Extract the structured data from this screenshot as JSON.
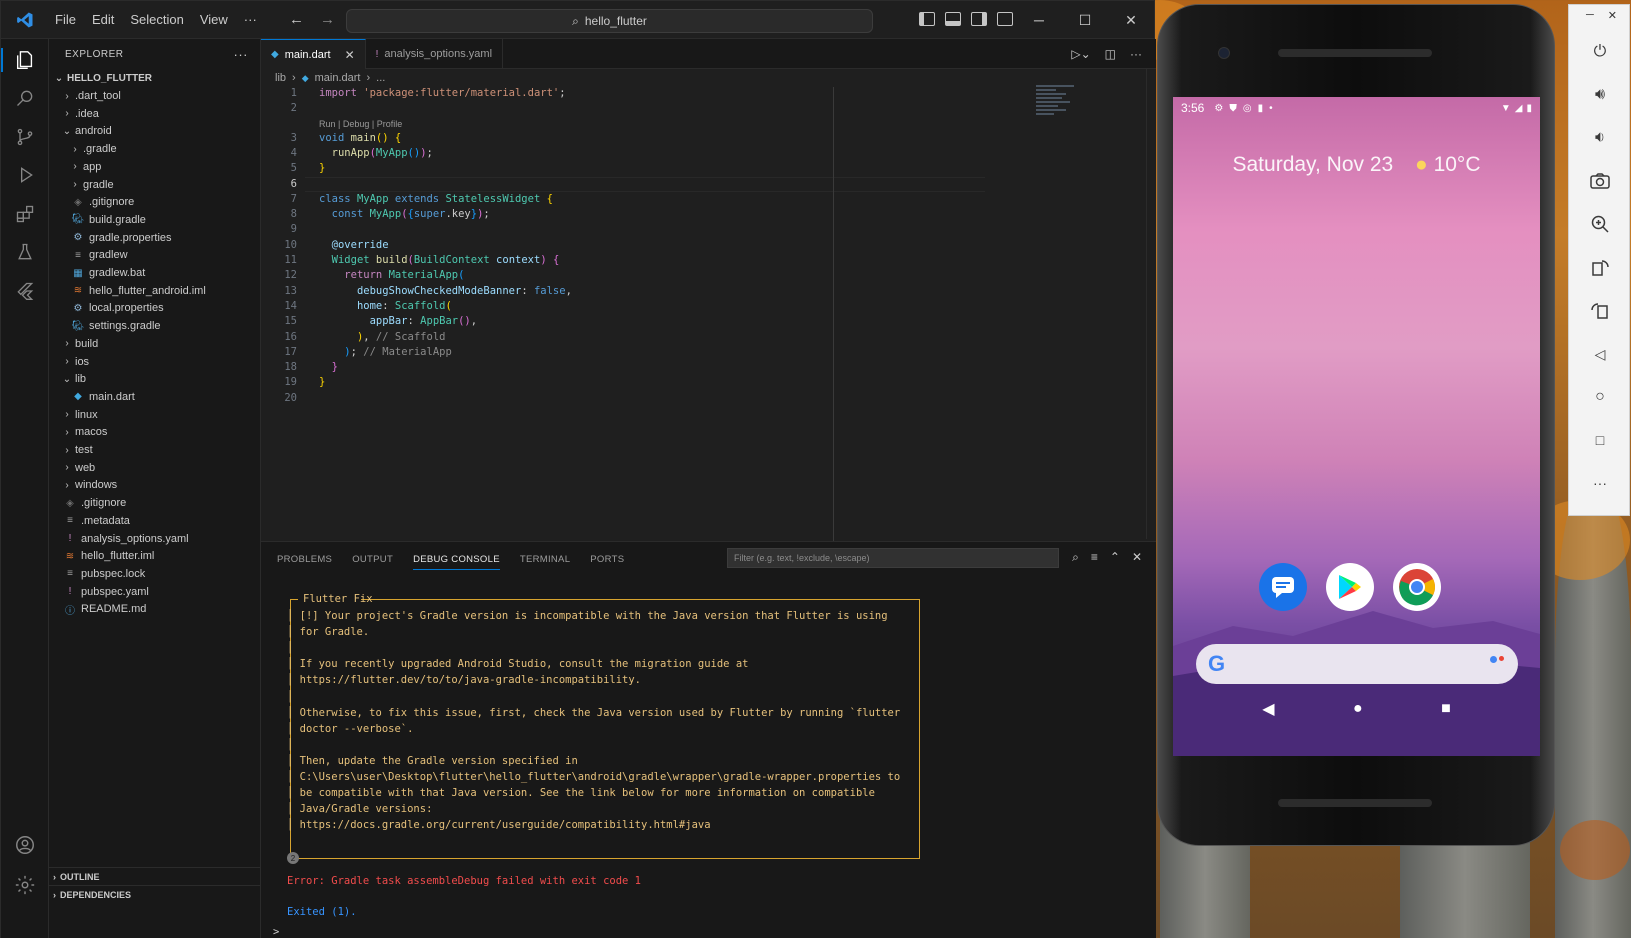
{
  "window": {
    "search_text": "hello_flutter",
    "menu": [
      "File",
      "Edit",
      "Selection",
      "View",
      "···"
    ]
  },
  "explorer": {
    "title": "EXPLORER",
    "root": "HELLO_FLUTTER",
    "items": [
      {
        "label": ".dart_tool",
        "type": "folder",
        "depth": 0,
        "open": false
      },
      {
        "label": ".idea",
        "type": "folder",
        "depth": 0,
        "open": false
      },
      {
        "label": "android",
        "type": "folder",
        "depth": 0,
        "open": true
      },
      {
        "label": ".gradle",
        "type": "folder",
        "depth": 1,
        "open": false
      },
      {
        "label": "app",
        "type": "folder",
        "depth": 1,
        "open": false
      },
      {
        "label": "gradle",
        "type": "folder",
        "depth": 1,
        "open": false
      },
      {
        "label": ".gitignore",
        "type": "file",
        "depth": 1,
        "icon": "gitignore-icon",
        "color": "#6c6c6c"
      },
      {
        "label": "build.gradle",
        "type": "file",
        "depth": 1,
        "icon": "gradle-icon",
        "color": "#4fa3d6"
      },
      {
        "label": "gradle.properties",
        "type": "file",
        "depth": 1,
        "icon": "gear-icon",
        "color": "#8fb7d8"
      },
      {
        "label": "gradlew",
        "type": "file",
        "depth": 1,
        "icon": "text-file-icon",
        "color": "#a0a0a0"
      },
      {
        "label": "gradlew.bat",
        "type": "file",
        "depth": 1,
        "icon": "bat-file-icon",
        "color": "#4fa3d6"
      },
      {
        "label": "hello_flutter_android.iml",
        "type": "file",
        "depth": 1,
        "icon": "iml-file-icon",
        "color": "#e37933"
      },
      {
        "label": "local.properties",
        "type": "file",
        "depth": 1,
        "icon": "gear-icon",
        "color": "#8fb7d8"
      },
      {
        "label": "settings.gradle",
        "type": "file",
        "depth": 1,
        "icon": "gradle-icon",
        "color": "#4fa3d6"
      },
      {
        "label": "build",
        "type": "folder",
        "depth": 0,
        "open": false
      },
      {
        "label": "ios",
        "type": "folder",
        "depth": 0,
        "open": false
      },
      {
        "label": "lib",
        "type": "folder",
        "depth": 0,
        "open": true
      },
      {
        "label": "main.dart",
        "type": "file",
        "depth": 1,
        "icon": "dart-icon",
        "color": "#40a9e0"
      },
      {
        "label": "linux",
        "type": "folder",
        "depth": 0,
        "open": false
      },
      {
        "label": "macos",
        "type": "folder",
        "depth": 0,
        "open": false
      },
      {
        "label": "test",
        "type": "folder",
        "depth": 0,
        "open": false
      },
      {
        "label": "web",
        "type": "folder",
        "depth": 0,
        "open": false
      },
      {
        "label": "windows",
        "type": "folder",
        "depth": 0,
        "open": false
      },
      {
        "label": ".gitignore",
        "type": "file",
        "depth": 0,
        "icon": "gitignore-icon",
        "color": "#6c6c6c"
      },
      {
        "label": ".metadata",
        "type": "file",
        "depth": 0,
        "icon": "text-file-icon",
        "color": "#a0a0a0"
      },
      {
        "label": "analysis_options.yaml",
        "type": "file",
        "depth": 0,
        "icon": "yaml-icon",
        "color": "#c586c0"
      },
      {
        "label": "hello_flutter.iml",
        "type": "file",
        "depth": 0,
        "icon": "iml-file-icon",
        "color": "#e37933"
      },
      {
        "label": "pubspec.lock",
        "type": "file",
        "depth": 0,
        "icon": "lock-file-icon",
        "color": "#a0a0a0"
      },
      {
        "label": "pubspec.yaml",
        "type": "file",
        "depth": 0,
        "icon": "yaml-icon",
        "color": "#c586c0"
      },
      {
        "label": "README.md",
        "type": "file",
        "depth": 0,
        "icon": "info-icon",
        "color": "#4fa3d6"
      }
    ],
    "outline": "OUTLINE",
    "dependencies": "DEPENDENCIES"
  },
  "editor": {
    "tabs": [
      {
        "label": "main.dart",
        "active": true
      },
      {
        "label": "analysis_options.yaml",
        "active": false
      }
    ],
    "breadcrumb": [
      "lib",
      "main.dart",
      "..."
    ],
    "codelens": "Run | Debug | Profile",
    "current_line": 6,
    "lines": [
      [
        [
          "k-kw2",
          "import "
        ],
        [
          "k-str",
          "'package:flutter/material.dart'"
        ],
        [
          "",
          "; "
        ]
      ],
      [],
      [
        [
          "k-kw",
          "void "
        ],
        [
          "k-fn",
          "main"
        ],
        [
          "k-p1",
          "()"
        ],
        [
          "",
          " "
        ],
        [
          "k-p1",
          "{"
        ]
      ],
      [
        [
          "",
          "  "
        ],
        [
          "k-fn",
          "runApp"
        ],
        [
          "k-p2",
          "("
        ],
        [
          "k-cls",
          "MyApp"
        ],
        [
          "k-p3",
          "()"
        ],
        [
          "k-p2",
          ")"
        ],
        [
          "",
          ";"
        ]
      ],
      [
        [
          "k-p1",
          "}"
        ]
      ],
      [],
      [
        [
          "k-kw",
          "class "
        ],
        [
          "k-cls",
          "MyApp "
        ],
        [
          "k-kw",
          "extends "
        ],
        [
          "k-cls",
          "StatelessWidget "
        ],
        [
          "k-p1",
          "{"
        ]
      ],
      [
        [
          "",
          "  "
        ],
        [
          "k-kw",
          "const "
        ],
        [
          "k-cls",
          "MyApp"
        ],
        [
          "k-p2",
          "("
        ],
        [
          "k-p3",
          "{"
        ],
        [
          "k-kw",
          "super"
        ],
        [
          "",
          ".key"
        ],
        [
          "k-p3",
          "}"
        ],
        [
          "k-p2",
          ")"
        ],
        [
          "",
          ";"
        ]
      ],
      [],
      [
        [
          "",
          "  "
        ],
        [
          "k-var",
          "@override"
        ]
      ],
      [
        [
          "",
          "  "
        ],
        [
          "k-cls",
          "Widget "
        ],
        [
          "k-fn",
          "build"
        ],
        [
          "k-p2",
          "("
        ],
        [
          "k-cls",
          "BuildContext "
        ],
        [
          "k-var",
          "context"
        ],
        [
          "k-p2",
          ")"
        ],
        [
          "",
          " "
        ],
        [
          "k-p2",
          "{"
        ]
      ],
      [
        [
          "",
          "    "
        ],
        [
          "k-kw2",
          "return "
        ],
        [
          "k-cls",
          "MaterialApp"
        ],
        [
          "k-p3",
          "("
        ]
      ],
      [
        [
          "",
          "      "
        ],
        [
          "k-var",
          "debugShowCheckedModeBanner"
        ],
        [
          "",
          ": "
        ],
        [
          "k-kw",
          "false"
        ],
        [
          "",
          ","
        ]
      ],
      [
        [
          "",
          "      "
        ],
        [
          "k-var",
          "home"
        ],
        [
          "",
          ": "
        ],
        [
          "k-cls",
          "Scaffold"
        ],
        [
          "k-p1",
          "("
        ]
      ],
      [
        [
          "",
          "        "
        ],
        [
          "k-var",
          "appBar"
        ],
        [
          "",
          ": "
        ],
        [
          "k-cls",
          "AppBar"
        ],
        [
          "k-p2",
          "()"
        ],
        [
          "",
          ","
        ]
      ],
      [
        [
          "",
          "      "
        ],
        [
          "k-p1",
          ")"
        ],
        [
          "",
          ", "
        ],
        [
          "k-cm",
          "// Scaffold"
        ]
      ],
      [
        [
          "",
          "    "
        ],
        [
          "k-p3",
          ")"
        ],
        [
          "",
          "; "
        ],
        [
          "k-cm",
          "// MaterialApp"
        ]
      ],
      [
        [
          "",
          "  "
        ],
        [
          "k-p2",
          "}"
        ]
      ],
      [
        [
          "k-p1",
          "}"
        ]
      ],
      []
    ]
  },
  "panel": {
    "tabs": [
      "PROBLEMS",
      "OUTPUT",
      "DEBUG CONSOLE",
      "TERMINAL",
      "PORTS"
    ],
    "active_tab": "DEBUG CONSOLE",
    "filter_placeholder": "Filter (e.g. text, !exclude, \\escape)",
    "fix_title": "Flutter Fix",
    "fix_lines": [
      "│ [!] Your project's Gradle version is incompatible with the Java version that Flutter is using",
      "│ for Gradle.",
      "│",
      "│ If you recently upgraded Android Studio, consult the migration guide at",
      "│ https://flutter.dev/to/to/java-gradle-incompatibility.",
      "│",
      "│ Otherwise, to fix this issue, first, check the Java version used by Flutter by running `flutter",
      "│ doctor --verbose`.",
      "│",
      "│ Then, update the Gradle version specified in",
      "│ C:\\Users\\user\\Desktop\\flutter\\hello_flutter\\android\\gradle\\wrapper\\gradle-wrapper.properties to",
      "│ be compatible with that Java version. See the link below for more information on compatible",
      "│ Java/Gradle versions:",
      "│ https://docs.gradle.org/current/userguide/compatibility.html#java"
    ],
    "repeat_count": "2",
    "error": "Error: Gradle task assembleDebug failed with exit code 1",
    "exited": "Exited (1).",
    "prompt": ">"
  },
  "emulator": {
    "time": "3:56",
    "date": "Saturday, Nov 23",
    "weather": "10°C",
    "toolbar": [
      "power-icon",
      "volume-up-icon",
      "volume-down-icon",
      "camera-icon",
      "zoom-icon",
      "rotate-left-icon",
      "rotate-right-icon",
      "back-icon",
      "home-icon",
      "overview-icon",
      "more-icon"
    ]
  },
  "colors": {
    "accent": "#0078d4",
    "error": "#f14c4c",
    "warning_box": "#d7a42f"
  }
}
